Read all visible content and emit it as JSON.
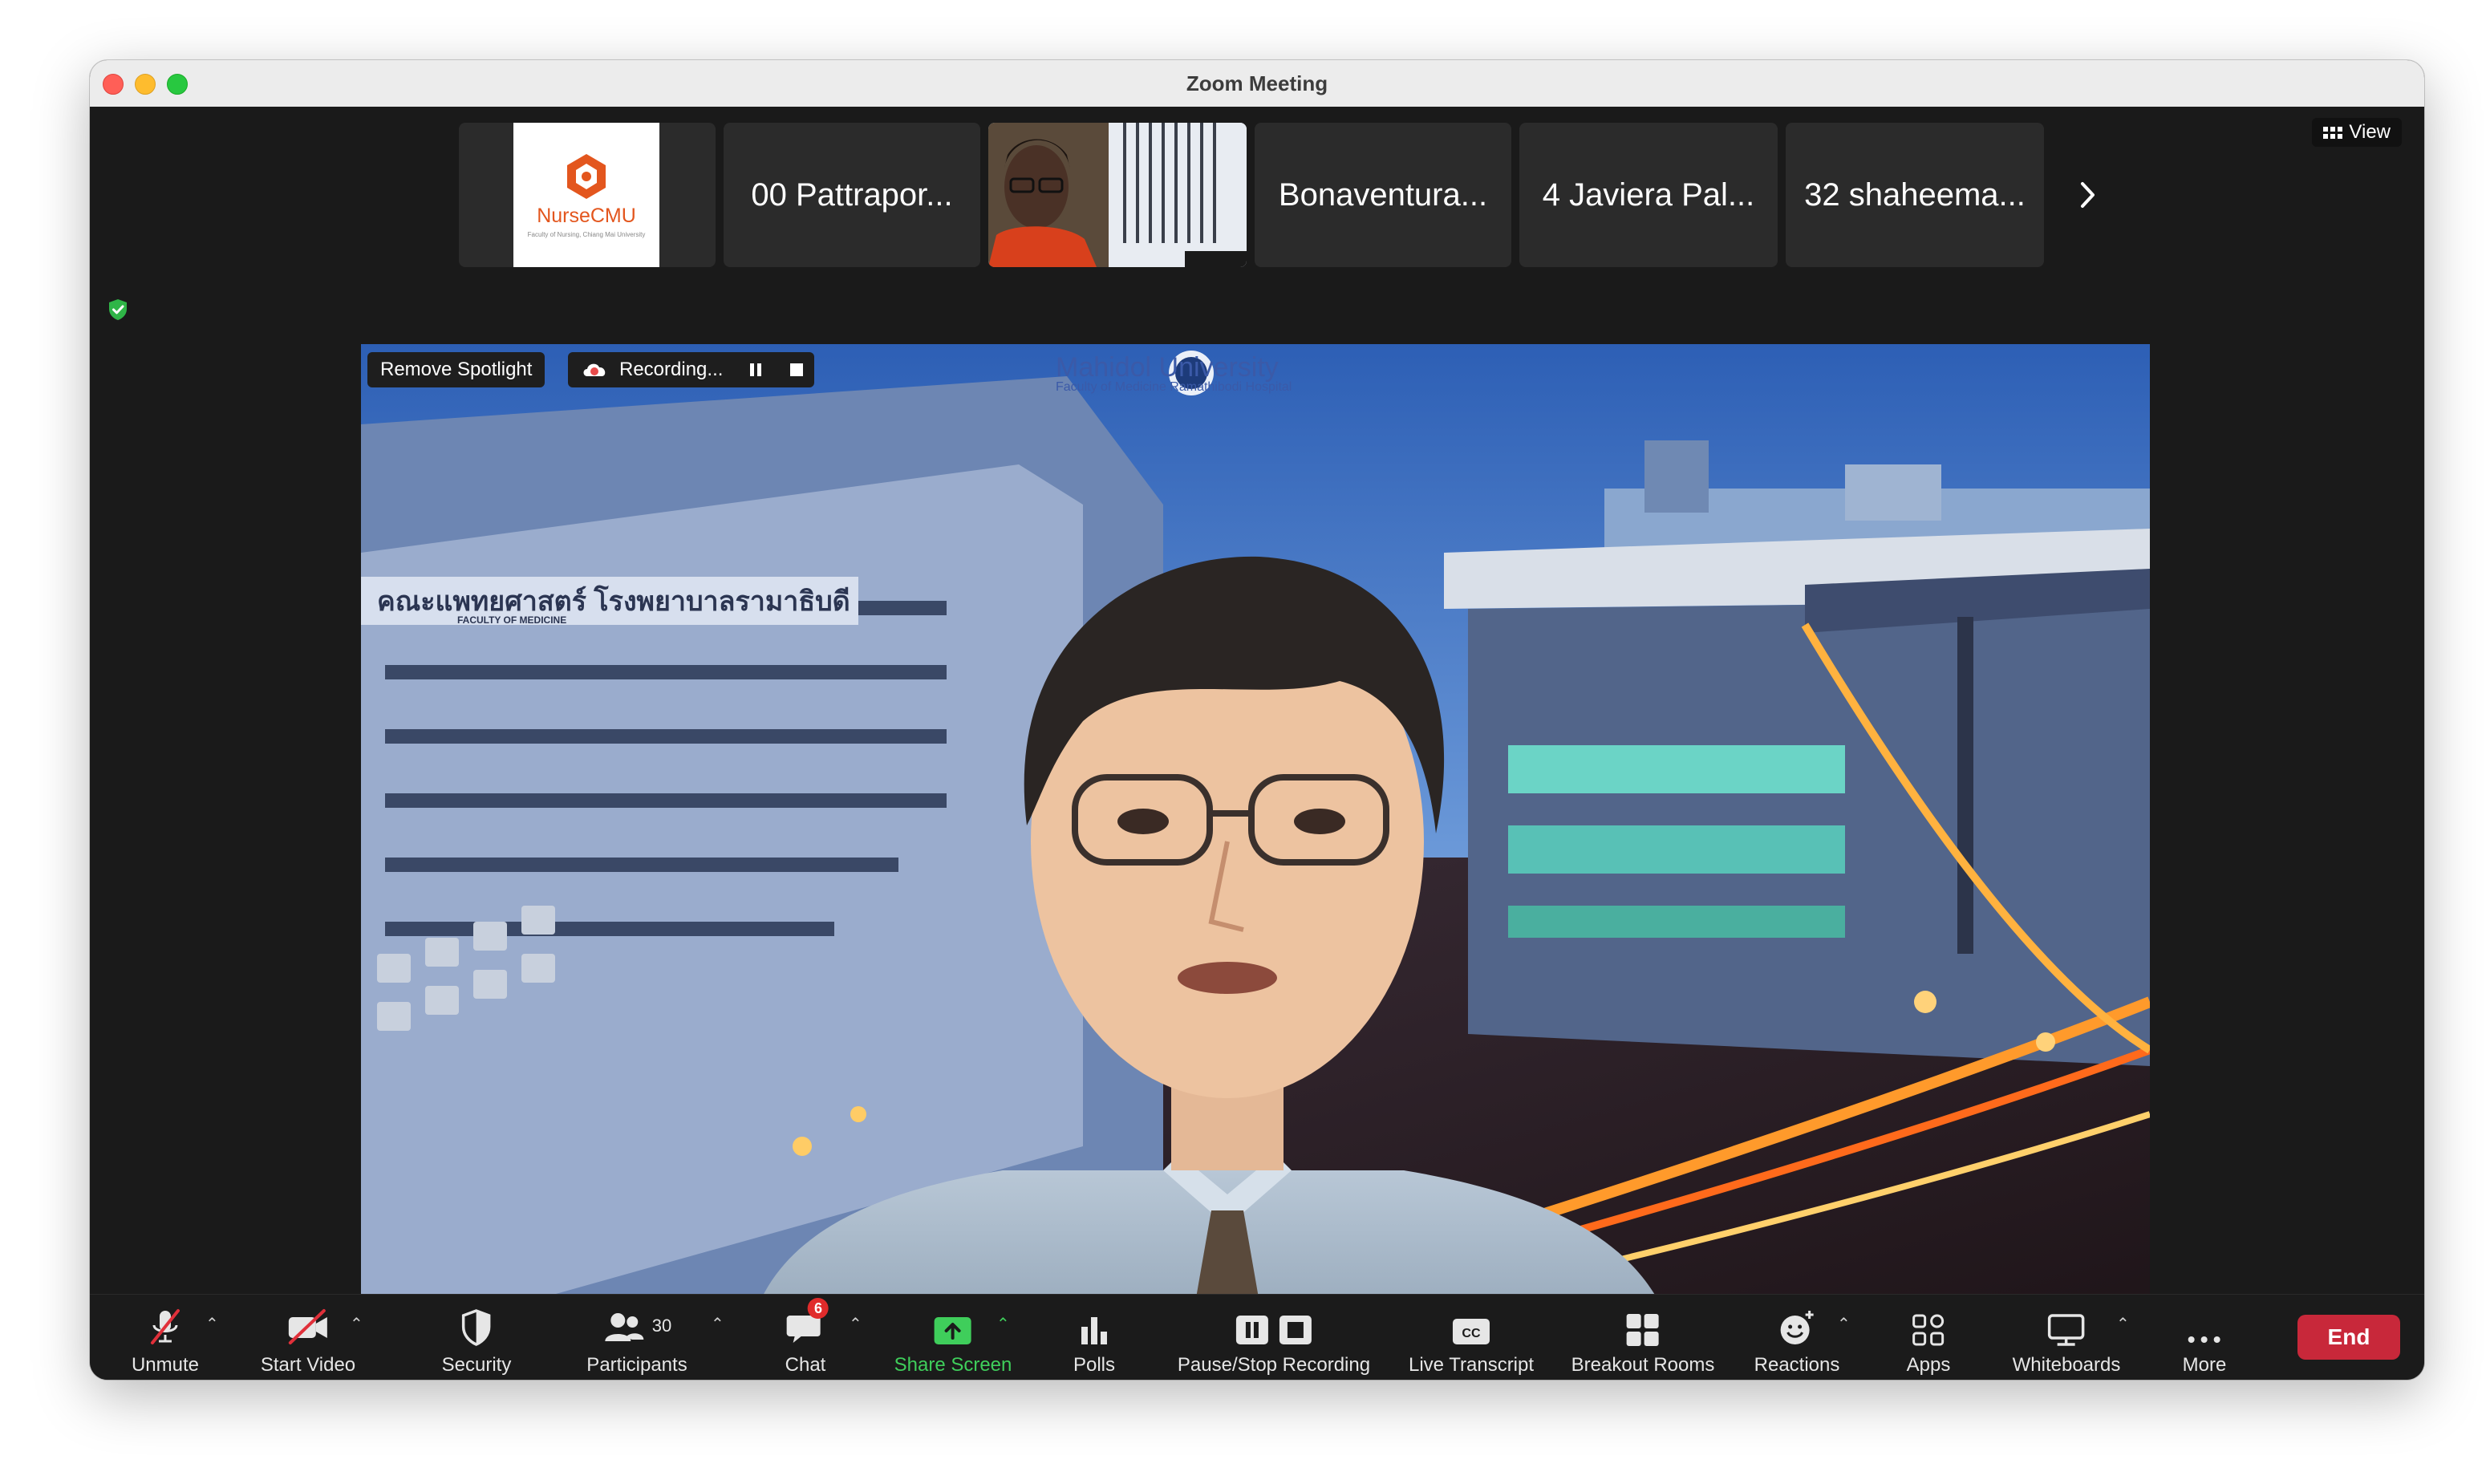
{
  "window": {
    "title": "Zoom Meeting"
  },
  "top_right": {
    "view_label": "View"
  },
  "participants_strip": {
    "tiles": [
      {
        "name": "",
        "kind": "logo",
        "logo_text": "NurseCMU",
        "logo_subtext": "Faculty of Nursing, Chiang Mai University"
      },
      {
        "name": "00 Pattrapor...",
        "kind": "name"
      },
      {
        "name": "",
        "kind": "video"
      },
      {
        "name": "Bonaventura...",
        "kind": "name"
      },
      {
        "name": "4 Javiera Pal...",
        "kind": "name"
      },
      {
        "name": "32 shaheema...",
        "kind": "name"
      }
    ],
    "next_icon": "chevron-right-icon"
  },
  "spotlight": {
    "remove_spotlight_label": "Remove Spotlight",
    "recording_label": "Recording...",
    "university_name": "Mahidol University",
    "university_subtitle": "Faculty of Medicine Ramathibodi Hospital",
    "building_sign": "คณะแพทยศาสตร์ โรงพยาบาลรามาธิบดี",
    "building_sign_en": "FACULTY OF MEDICINE"
  },
  "toolbar": {
    "unmute": "Unmute",
    "start_video": "Start Video",
    "security": "Security",
    "participants": "Participants",
    "participants_count": "30",
    "chat": "Chat",
    "chat_badge": "6",
    "share_screen": "Share Screen",
    "polls": "Polls",
    "pause_stop_recording": "Pause/Stop Recording",
    "live_transcript": "Live Transcript",
    "cc_glyph": "CC",
    "breakout_rooms": "Breakout Rooms",
    "reactions": "Reactions",
    "apps": "Apps",
    "whiteboards": "Whiteboards",
    "more": "More",
    "end": "End"
  },
  "colors": {
    "share_green": "#3fce5b",
    "end_red": "#c8283a",
    "badge_red": "#e02b2b",
    "shield_green": "#2fb547",
    "recording_red": "#e84b4b"
  }
}
